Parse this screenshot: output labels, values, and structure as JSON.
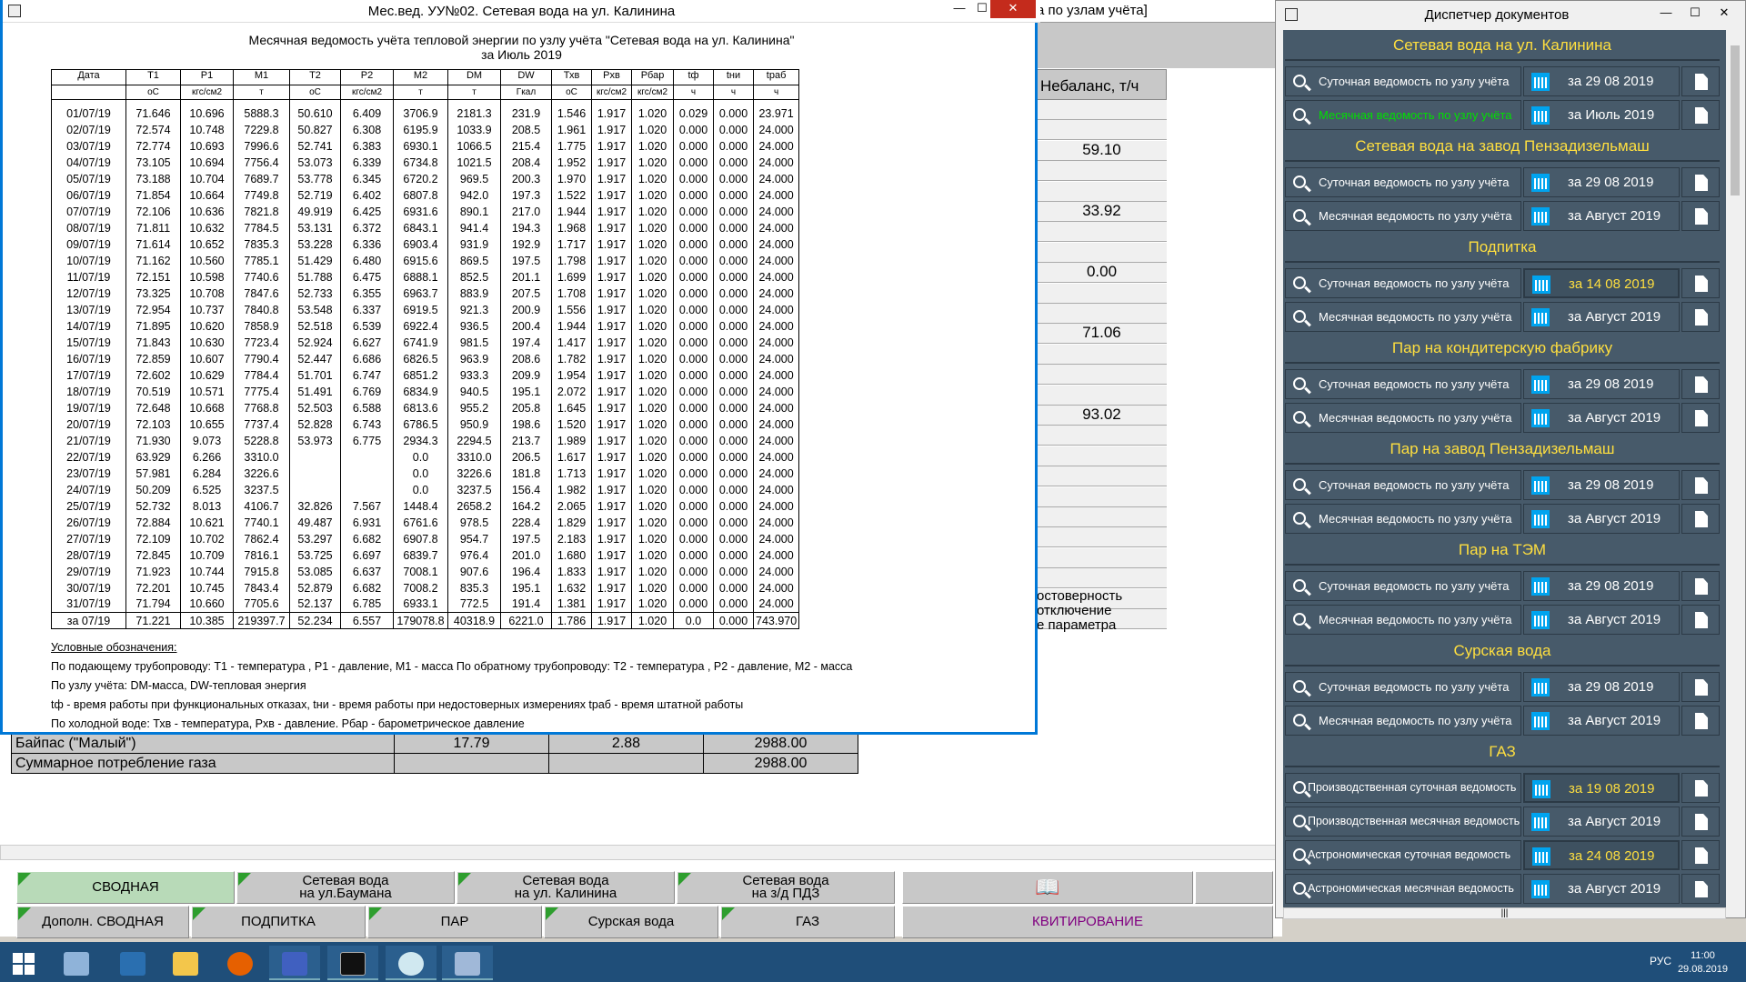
{
  "bg": {
    "title_fragment": "а по узлам учёта]",
    "nebalans_header": "Небаланс, т/ч",
    "nebalans_values": [
      "59.10",
      "33.92",
      "0.00",
      "71.06",
      "93.02"
    ],
    "overlay_lines": [
      "остоверность",
      "отключение",
      "е параметра"
    ],
    "gas_rows": [
      {
        "name": "Байпас (\"Малый\")",
        "v1": "17.79",
        "v2": "2.88",
        "v3": "2988.00"
      },
      {
        "name": "Суммарное потребление газа",
        "v1": "",
        "v2": "",
        "v3": "2988.00"
      }
    ],
    "tabs_row1": [
      {
        "label1": "СВОДНАЯ",
        "label2": ""
      },
      {
        "label1": "Сетевая вода",
        "label2": "на ул.Баумана"
      },
      {
        "label1": "Сетевая вода",
        "label2": "на ул. Калинина"
      },
      {
        "label1": "Сетевая вода",
        "label2": "на з/д ПДЗ"
      }
    ],
    "tabs_row2": [
      "Дополн. СВОДНАЯ",
      "ПОДПИТКА",
      "ПАР",
      "Сурская вода",
      "ГАЗ"
    ],
    "kvit_label": "КВИТИРОВАНИЕ"
  },
  "doc": {
    "window_title": "Мес.вед. УУ№02. Сетевая вода на ул. Калинина",
    "report_title": "Месячная ведомость учёта тепловой энергии по узлу учёта \"Сетевая вода на ул. Калинина\"",
    "report_period": "за Июль 2019",
    "headers": [
      "Дата",
      "T1",
      "P1",
      "M1",
      "T2",
      "P2",
      "M2",
      "DM",
      "DW",
      "Тхв",
      "Рхв",
      "Рбар",
      "tф",
      "tни",
      "tраб"
    ],
    "units": [
      "",
      "oC",
      "кгс/см2",
      "т",
      "oC",
      "кгс/см2",
      "т",
      "т",
      "Гкал",
      "oC",
      "кгс/см2",
      "кгс/см2",
      "ч",
      "ч",
      "ч"
    ],
    "rows": [
      [
        "01/07/19",
        "71.646",
        "10.696",
        "5888.3",
        "50.610",
        "6.409",
        "3706.9",
        "2181.3",
        "231.9",
        "1.546",
        "1.917",
        "1.020",
        "0.029",
        "0.000",
        "23.971"
      ],
      [
        "02/07/19",
        "72.574",
        "10.748",
        "7229.8",
        "50.827",
        "6.308",
        "6195.9",
        "1033.9",
        "208.5",
        "1.961",
        "1.917",
        "1.020",
        "0.000",
        "0.000",
        "24.000"
      ],
      [
        "03/07/19",
        "72.774",
        "10.693",
        "7996.6",
        "52.741",
        "6.383",
        "6930.1",
        "1066.5",
        "215.4",
        "1.775",
        "1.917",
        "1.020",
        "0.000",
        "0.000",
        "24.000"
      ],
      [
        "04/07/19",
        "73.105",
        "10.694",
        "7756.4",
        "53.073",
        "6.339",
        "6734.8",
        "1021.5",
        "208.4",
        "1.952",
        "1.917",
        "1.020",
        "0.000",
        "0.000",
        "24.000"
      ],
      [
        "05/07/19",
        "73.188",
        "10.704",
        "7689.7",
        "53.778",
        "6.345",
        "6720.2",
        "969.5",
        "200.3",
        "1.970",
        "1.917",
        "1.020",
        "0.000",
        "0.000",
        "24.000"
      ],
      [
        "06/07/19",
        "71.854",
        "10.664",
        "7749.8",
        "52.719",
        "6.402",
        "6807.8",
        "942.0",
        "197.3",
        "1.522",
        "1.917",
        "1.020",
        "0.000",
        "0.000",
        "24.000"
      ],
      [
        "07/07/19",
        "72.106",
        "10.636",
        "7821.8",
        "49.919",
        "6.425",
        "6931.6",
        "890.1",
        "217.0",
        "1.944",
        "1.917",
        "1.020",
        "0.000",
        "0.000",
        "24.000"
      ],
      [
        "08/07/19",
        "71.811",
        "10.632",
        "7784.5",
        "53.131",
        "6.372",
        "6843.1",
        "941.4",
        "194.3",
        "1.968",
        "1.917",
        "1.020",
        "0.000",
        "0.000",
        "24.000"
      ],
      [
        "09/07/19",
        "71.614",
        "10.652",
        "7835.3",
        "53.228",
        "6.336",
        "6903.4",
        "931.9",
        "192.9",
        "1.717",
        "1.917",
        "1.020",
        "0.000",
        "0.000",
        "24.000"
      ],
      [
        "10/07/19",
        "71.162",
        "10.560",
        "7785.1",
        "51.429",
        "6.480",
        "6915.6",
        "869.5",
        "197.5",
        "1.798",
        "1.917",
        "1.020",
        "0.000",
        "0.000",
        "24.000"
      ],
      [
        "11/07/19",
        "72.151",
        "10.598",
        "7740.6",
        "51.788",
        "6.475",
        "6888.1",
        "852.5",
        "201.1",
        "1.699",
        "1.917",
        "1.020",
        "0.000",
        "0.000",
        "24.000"
      ],
      [
        "12/07/19",
        "73.325",
        "10.708",
        "7847.6",
        "52.733",
        "6.355",
        "6963.7",
        "883.9",
        "207.5",
        "1.708",
        "1.917",
        "1.020",
        "0.000",
        "0.000",
        "24.000"
      ],
      [
        "13/07/19",
        "72.954",
        "10.737",
        "7840.8",
        "53.548",
        "6.337",
        "6919.5",
        "921.3",
        "200.9",
        "1.556",
        "1.917",
        "1.020",
        "0.000",
        "0.000",
        "24.000"
      ],
      [
        "14/07/19",
        "71.895",
        "10.620",
        "7858.9",
        "52.518",
        "6.539",
        "6922.4",
        "936.5",
        "200.4",
        "1.944",
        "1.917",
        "1.020",
        "0.000",
        "0.000",
        "24.000"
      ],
      [
        "15/07/19",
        "71.843",
        "10.630",
        "7723.4",
        "52.924",
        "6.627",
        "6741.9",
        "981.5",
        "197.4",
        "1.417",
        "1.917",
        "1.020",
        "0.000",
        "0.000",
        "24.000"
      ],
      [
        "16/07/19",
        "72.859",
        "10.607",
        "7790.4",
        "52.447",
        "6.686",
        "6826.5",
        "963.9",
        "208.6",
        "1.782",
        "1.917",
        "1.020",
        "0.000",
        "0.000",
        "24.000"
      ],
      [
        "17/07/19",
        "72.602",
        "10.629",
        "7784.4",
        "51.701",
        "6.747",
        "6851.2",
        "933.3",
        "209.9",
        "1.954",
        "1.917",
        "1.020",
        "0.000",
        "0.000",
        "24.000"
      ],
      [
        "18/07/19",
        "70.519",
        "10.571",
        "7775.4",
        "51.491",
        "6.769",
        "6834.9",
        "940.5",
        "195.1",
        "2.072",
        "1.917",
        "1.020",
        "0.000",
        "0.000",
        "24.000"
      ],
      [
        "19/07/19",
        "72.648",
        "10.668",
        "7768.8",
        "52.503",
        "6.588",
        "6813.6",
        "955.2",
        "205.8",
        "1.645",
        "1.917",
        "1.020",
        "0.000",
        "0.000",
        "24.000"
      ],
      [
        "20/07/19",
        "72.103",
        "10.655",
        "7737.4",
        "52.828",
        "6.743",
        "6786.5",
        "950.9",
        "198.6",
        "1.520",
        "1.917",
        "1.020",
        "0.000",
        "0.000",
        "24.000"
      ],
      [
        "21/07/19",
        "71.930",
        "9.073",
        "5228.8",
        "53.973",
        "6.775",
        "2934.3",
        "2294.5",
        "213.7",
        "1.989",
        "1.917",
        "1.020",
        "0.000",
        "0.000",
        "24.000"
      ],
      [
        "22/07/19",
        "63.929",
        "6.266",
        "3310.0",
        "",
        "",
        "0.0",
        "3310.0",
        "206.5",
        "1.617",
        "1.917",
        "1.020",
        "0.000",
        "0.000",
        "24.000"
      ],
      [
        "23/07/19",
        "57.981",
        "6.284",
        "3226.6",
        "",
        "",
        "0.0",
        "3226.6",
        "181.8",
        "1.713",
        "1.917",
        "1.020",
        "0.000",
        "0.000",
        "24.000"
      ],
      [
        "24/07/19",
        "50.209",
        "6.525",
        "3237.5",
        "",
        "",
        "0.0",
        "3237.5",
        "156.4",
        "1.982",
        "1.917",
        "1.020",
        "0.000",
        "0.000",
        "24.000"
      ],
      [
        "25/07/19",
        "52.732",
        "8.013",
        "4106.7",
        "32.826",
        "7.567",
        "1448.4",
        "2658.2",
        "164.2",
        "2.065",
        "1.917",
        "1.020",
        "0.000",
        "0.000",
        "24.000"
      ],
      [
        "26/07/19",
        "72.884",
        "10.621",
        "7740.1",
        "49.487",
        "6.931",
        "6761.6",
        "978.5",
        "228.4",
        "1.829",
        "1.917",
        "1.020",
        "0.000",
        "0.000",
        "24.000"
      ],
      [
        "27/07/19",
        "72.109",
        "10.702",
        "7862.4",
        "53.297",
        "6.682",
        "6907.8",
        "954.7",
        "197.5",
        "2.183",
        "1.917",
        "1.020",
        "0.000",
        "0.000",
        "24.000"
      ],
      [
        "28/07/19",
        "72.845",
        "10.709",
        "7816.1",
        "53.725",
        "6.697",
        "6839.7",
        "976.4",
        "201.0",
        "1.680",
        "1.917",
        "1.020",
        "0.000",
        "0.000",
        "24.000"
      ],
      [
        "29/07/19",
        "71.923",
        "10.744",
        "7915.8",
        "53.085",
        "6.637",
        "7008.1",
        "907.6",
        "196.4",
        "1.833",
        "1.917",
        "1.020",
        "0.000",
        "0.000",
        "24.000"
      ],
      [
        "30/07/19",
        "72.201",
        "10.745",
        "7843.4",
        "52.879",
        "6.682",
        "7008.2",
        "835.3",
        "195.1",
        "1.632",
        "1.917",
        "1.020",
        "0.000",
        "0.000",
        "24.000"
      ],
      [
        "31/07/19",
        "71.794",
        "10.660",
        "7705.6",
        "52.137",
        "6.785",
        "6933.1",
        "772.5",
        "191.4",
        "1.381",
        "1.917",
        "1.020",
        "0.000",
        "0.000",
        "24.000"
      ]
    ],
    "total": [
      "за 07/19",
      "71.221",
      "10.385",
      "219397.7",
      "52.234",
      "6.557",
      "179078.8",
      "40318.9",
      "6221.0",
      "1.786",
      "1.917",
      "1.020",
      "0.0",
      "0.000",
      "743.970"
    ],
    "legend": [
      "Условные обозначения:",
      "По подающему трубопроводу: T1 - температура , P1 - давление, M1 - масса    По обратному трубопроводу:     T2 - температура , P2 - давление, M2 - масса",
      "По узлу учёта: DM-масса, DW-тепловая энергия",
      "tф - время работы при функциональных отказах, tни - время работы при недостоверных измерениях  tраб - время штатной работы",
      "По холодной воде: Тхв - температура, Рхв - давление. Рбар - барометрическое давление"
    ]
  },
  "manager": {
    "title": "Диспетчер документов",
    "groups": [
      {
        "name": "Сетевая вода на ул. Калинина",
        "rows": [
          {
            "label": "Суточная ведомость по узлу учёта",
            "date": "за 29 08 2019",
            "sel": false,
            "hi": false
          },
          {
            "label": "Месячная ведомость по узлу учёта",
            "date": "за Июль 2019",
            "sel": true,
            "hi": false
          }
        ]
      },
      {
        "name": "Сетевая вода на завод Пензадизельмаш",
        "rows": [
          {
            "label": "Суточная ведомость по узлу учёта",
            "date": "за 29 08 2019",
            "sel": false,
            "hi": false
          },
          {
            "label": "Месячная ведомость по узлу учёта",
            "date": "за Август 2019",
            "sel": false,
            "hi": false
          }
        ]
      },
      {
        "name": "Подпитка",
        "rows": [
          {
            "label": "Суточная ведомость по узлу учёта",
            "date": "за 14 08 2019",
            "sel": false,
            "hi": true
          },
          {
            "label": "Месячная ведомость по узлу учёта",
            "date": "за Август 2019",
            "sel": false,
            "hi": false
          }
        ]
      },
      {
        "name": "Пар на кондитерскую фабрику",
        "rows": [
          {
            "label": "Суточная ведомость по узлу учёта",
            "date": "за 29 08 2019",
            "sel": false,
            "hi": false
          },
          {
            "label": "Месячная ведомость по узлу учёта",
            "date": "за Август 2019",
            "sel": false,
            "hi": false
          }
        ]
      },
      {
        "name": "Пар на завод Пензадизельмаш",
        "rows": [
          {
            "label": "Суточная ведомость по узлу учёта",
            "date": "за 29 08 2019",
            "sel": false,
            "hi": false
          },
          {
            "label": "Месячная ведомость по узлу учёта",
            "date": "за Август 2019",
            "sel": false,
            "hi": false
          }
        ]
      },
      {
        "name": "Пар на ТЭМ",
        "rows": [
          {
            "label": "Суточная ведомость по узлу учёта",
            "date": "за 29 08 2019",
            "sel": false,
            "hi": false
          },
          {
            "label": "Месячная ведомость по узлу учёта",
            "date": "за Август 2019",
            "sel": false,
            "hi": false
          }
        ]
      },
      {
        "name": "Сурская вода",
        "rows": [
          {
            "label": "Суточная ведомость по узлу учёта",
            "date": "за 29 08 2019",
            "sel": false,
            "hi": false
          },
          {
            "label": "Месячная ведомость по узлу учёта",
            "date": "за Август 2019",
            "sel": false,
            "hi": false
          }
        ]
      },
      {
        "name": "ГАЗ",
        "rows": [
          {
            "label": "Производственная суточная ведомость",
            "date": "за 19 08 2019",
            "sel": false,
            "hi": true
          },
          {
            "label": "Производственная месячная ведомость",
            "date": "за Август 2019",
            "sel": false,
            "hi": false
          },
          {
            "label": "Астрономическая суточная ведомость",
            "date": "за 24 08 2019",
            "sel": false,
            "hi": true
          },
          {
            "label": "Астрономическая месячная ведомость",
            "date": "за Август 2019",
            "sel": false,
            "hi": false
          }
        ]
      }
    ]
  },
  "taskbar": {
    "lang": "РУС",
    "time": "11:00",
    "date": "29.08.2019"
  }
}
